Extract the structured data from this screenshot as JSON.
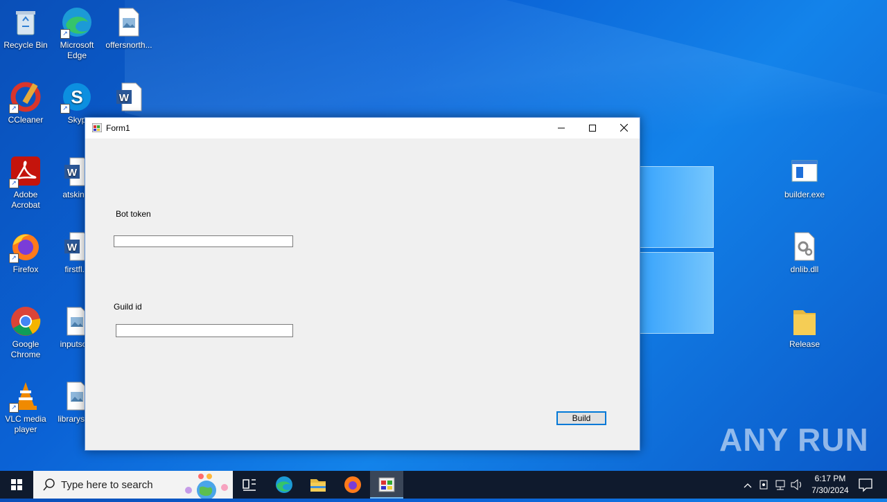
{
  "desktop": {
    "icons_left": [
      {
        "label": "Recycle Bin",
        "icon": "recycle-bin-icon"
      },
      {
        "label": "Microsoft Edge",
        "icon": "edge-icon"
      },
      {
        "label": "offersnorth...",
        "icon": "image-file-icon"
      },
      {
        "label": "CCleaner",
        "icon": "ccleaner-icon"
      },
      {
        "label": "Skyp",
        "icon": "skype-icon"
      },
      {
        "label": "",
        "icon": "word-doc-icon"
      },
      {
        "label": "Adobe Acrobat",
        "icon": "acrobat-icon"
      },
      {
        "label": "atskin...",
        "icon": "word-doc-icon"
      },
      {
        "label": "Firefox",
        "icon": "firefox-icon"
      },
      {
        "label": "firstfl...",
        "icon": "word-doc-icon"
      },
      {
        "label": "Google Chrome",
        "icon": "chrome-icon"
      },
      {
        "label": "inputso...",
        "icon": "image-file-icon"
      },
      {
        "label": "VLC media player",
        "icon": "vlc-icon"
      },
      {
        "label": "librarysu...",
        "icon": "image-file-icon"
      }
    ],
    "icons_right": [
      {
        "label": "builder.exe",
        "icon": "exe-file-icon"
      },
      {
        "label": "dnlib.dll",
        "icon": "dll-file-icon"
      },
      {
        "label": "Release",
        "icon": "folder-icon"
      }
    ],
    "watermark": "ANY RUN"
  },
  "window": {
    "title": "Form1",
    "minimize": "—",
    "maximize": "☐",
    "close": "✕",
    "form": {
      "bot_token_label": "Bot token",
      "bot_token_value": "",
      "guild_id_label": "Guild id",
      "guild_id_value": "",
      "build_label": "Build"
    }
  },
  "taskbar": {
    "search_placeholder": "Type here to search",
    "time": "6:17 PM",
    "date": "7/30/2024"
  }
}
